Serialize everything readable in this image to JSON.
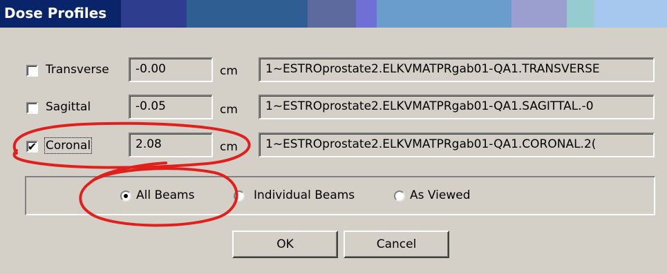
{
  "window": {
    "title": "Dose Profiles"
  },
  "rows": [
    {
      "label": "Transverse",
      "checked": false,
      "value": "-0.00",
      "unit": "cm",
      "file": "1~ESTROprostate2.ELKVMATPRgab01-QA1.TRANSVERSE"
    },
    {
      "label": "Sagittal",
      "checked": false,
      "value": "-0.05",
      "unit": "cm",
      "file": "1~ESTROprostate2.ELKVMATPRgab01-QA1.SAGITTAL.-0"
    },
    {
      "label": "Coronal",
      "checked": true,
      "value": "2.08",
      "unit": "cm",
      "file": "1~ESTROprostate2.ELKVMATPRgab01-QA1.CORONAL.2("
    }
  ],
  "beam_options": {
    "selected": "All Beams",
    "options": [
      "All Beams",
      "Individual Beams",
      "As Viewed"
    ]
  },
  "buttons": {
    "ok": "OK",
    "cancel": "Cancel"
  },
  "check_glyph": "✔",
  "colors": {
    "annotation": "#e0201c",
    "title_text": "#ffffff"
  }
}
